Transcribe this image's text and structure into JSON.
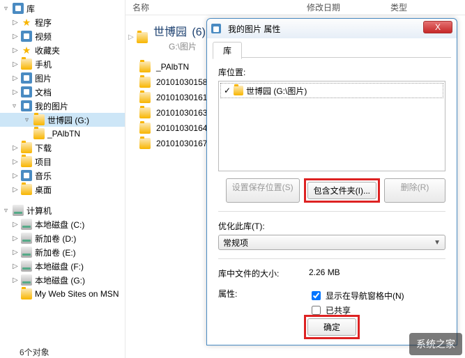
{
  "sidebar": {
    "header": "库",
    "items": [
      {
        "label": "程序",
        "indent": 1,
        "arrow": "▷",
        "icon": "star"
      },
      {
        "label": "视频",
        "indent": 1,
        "arrow": "▷",
        "icon": "lib"
      },
      {
        "label": "收藏夹",
        "indent": 1,
        "arrow": "▷",
        "icon": "star"
      },
      {
        "label": "手机",
        "indent": 1,
        "arrow": "▷",
        "icon": "folder"
      },
      {
        "label": "图片",
        "indent": 1,
        "arrow": "▷",
        "icon": "lib"
      },
      {
        "label": "文档",
        "indent": 1,
        "arrow": "▷",
        "icon": "lib"
      },
      {
        "label": "我的图片",
        "indent": 1,
        "arrow": "▿",
        "icon": "lib"
      },
      {
        "label": "世博园 (G:)",
        "indent": 2,
        "arrow": "▿",
        "icon": "folder",
        "selected": true
      },
      {
        "label": "_PAlbTN",
        "indent": 2,
        "arrow": "",
        "icon": "folder"
      },
      {
        "label": "下载",
        "indent": 1,
        "arrow": "▷",
        "icon": "folder"
      },
      {
        "label": "项目",
        "indent": 1,
        "arrow": "▷",
        "icon": "folder"
      },
      {
        "label": "音乐",
        "indent": 1,
        "arrow": "▷",
        "icon": "lib"
      },
      {
        "label": "桌面",
        "indent": 1,
        "arrow": "▷",
        "icon": "folder"
      }
    ],
    "header2": "计算机",
    "drives": [
      {
        "label": "本地磁盘 (C:)",
        "arrow": "▷"
      },
      {
        "label": "新加卷 (D:)",
        "arrow": "▷"
      },
      {
        "label": "新加卷 (E:)",
        "arrow": "▷"
      },
      {
        "label": "本地磁盘 (F:)",
        "arrow": "▷"
      },
      {
        "label": "本地磁盘 (G:)",
        "arrow": "▷"
      },
      {
        "label": "My Web Sites on MSN",
        "arrow": ""
      }
    ],
    "cutoff": "6个对象"
  },
  "main": {
    "cols": {
      "name": "名称",
      "date": "修改日期",
      "type": "类型"
    },
    "crumb": {
      "title": "世博园",
      "count": "(6)",
      "sub": "G:\\图片"
    },
    "files": [
      {
        "label": "_PAlbTN"
      },
      {
        "label": "20101030158"
      },
      {
        "label": "20101030161"
      },
      {
        "label": "20101030163"
      },
      {
        "label": "20101030164"
      },
      {
        "label": "20101030167"
      }
    ]
  },
  "dialog": {
    "title": "我的图片 属性",
    "close": "X",
    "tab": "库",
    "loc_label": "库位置:",
    "loc_item": "世博园 (G:\\图片)",
    "check": "✓",
    "btn_setloc": "设置保存位置(S)",
    "btn_include": "包含文件夹(I)...",
    "btn_remove": "删除(R)",
    "optimize_label": "优化此库(T):",
    "optimize_value": "常规项",
    "size_label": "库中文件的大小:",
    "size_value": "2.26 MB",
    "attr_label": "属性:",
    "chk_nav": "显示在导航窗格中(N)",
    "chk_shared": "已共享",
    "ok": "确定"
  },
  "watermark": "系统之家"
}
